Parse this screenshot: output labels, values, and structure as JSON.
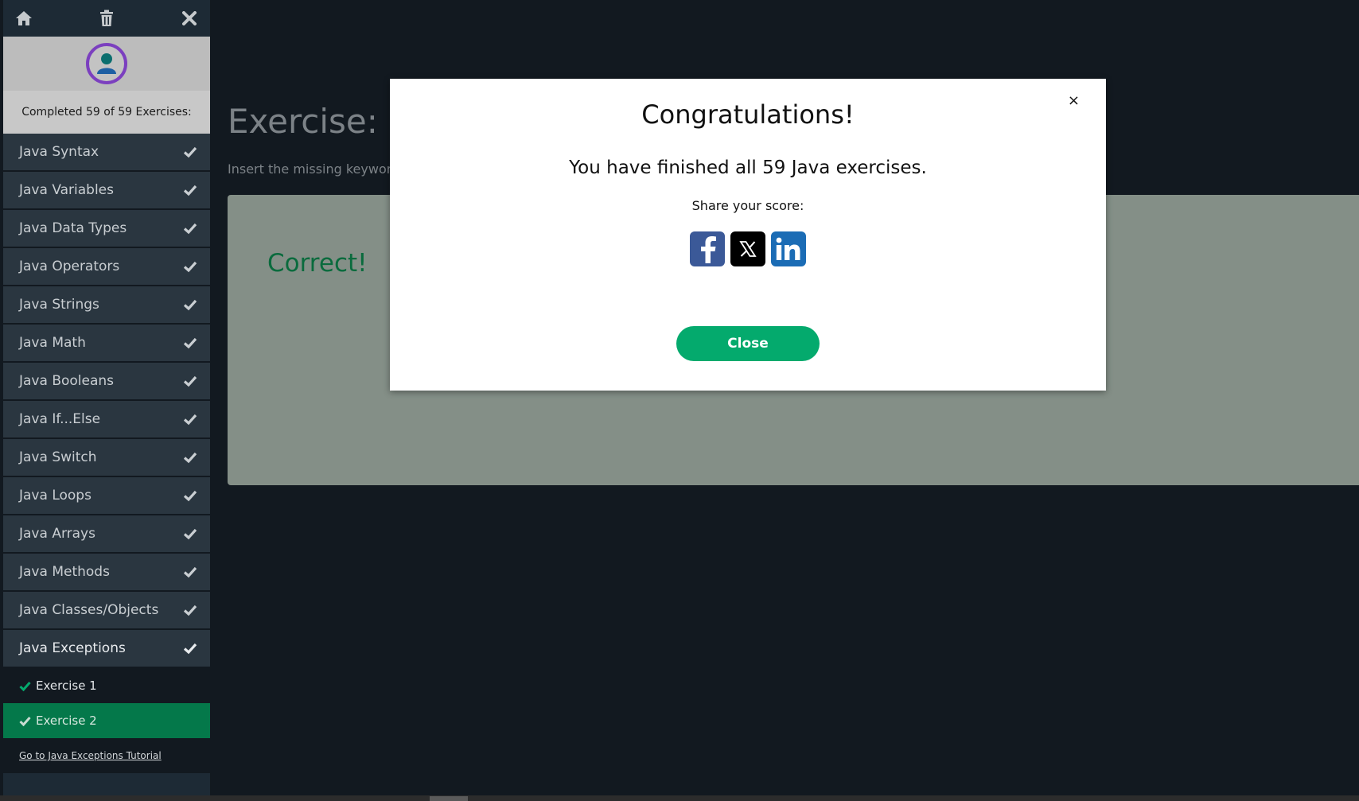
{
  "sidebar": {
    "completed_text": "Completed 59 of 59 Exercises:",
    "topics": [
      {
        "label": "Java Syntax"
      },
      {
        "label": "Java Variables"
      },
      {
        "label": "Java Data Types"
      },
      {
        "label": "Java Operators"
      },
      {
        "label": "Java Strings"
      },
      {
        "label": "Java Math"
      },
      {
        "label": "Java Booleans"
      },
      {
        "label": "Java If...Else"
      },
      {
        "label": "Java Switch"
      },
      {
        "label": "Java Loops"
      },
      {
        "label": "Java Arrays"
      },
      {
        "label": "Java Methods"
      },
      {
        "label": "Java Classes/Objects"
      },
      {
        "label": "Java Exceptions"
      }
    ],
    "exercises": [
      {
        "label": "Exercise 1"
      },
      {
        "label": "Exercise 2"
      }
    ],
    "tutorial_link": "Go to Java Exceptions Tutorial",
    "icons": [
      "home-icon",
      "trash-icon",
      "close-icon",
      "user-icon",
      "checkmark-icon"
    ]
  },
  "main": {
    "title": "Exercise:",
    "instruction": "Insert the missing keyword",
    "result": "Correct!"
  },
  "modal": {
    "title": "Congratulations!",
    "message": "You have finished all 59 Java exercises.",
    "share_label": "Share your score:",
    "close_button": "Close",
    "close_x": "×"
  },
  "colors": {
    "accent": "#04aa6d",
    "current_exercise_bg": "#04784a",
    "avatar_ring": "#7b3fbf",
    "background": "#121920"
  }
}
